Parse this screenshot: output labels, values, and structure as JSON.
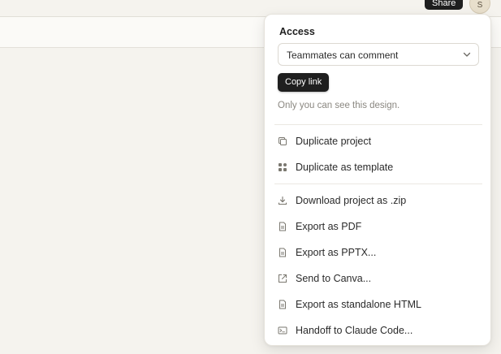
{
  "header": {
    "share_label": "Share",
    "avatar_initial": "S"
  },
  "panel": {
    "access_title": "Access",
    "access_value": "Teammates can comment",
    "copy_link_label": "Copy link",
    "visibility_note": "Only you can see this design.",
    "items": [
      {
        "label": "Duplicate project",
        "icon": "duplicate-icon"
      },
      {
        "label": "Duplicate as template",
        "icon": "template-icon"
      },
      {
        "label": "Download project as .zip",
        "icon": "download-icon"
      },
      {
        "label": "Export as PDF",
        "icon": "file-icon"
      },
      {
        "label": "Export as PPTX...",
        "icon": "file-icon"
      },
      {
        "label": "Send to Canva...",
        "icon": "external-link-icon"
      },
      {
        "label": "Export as standalone HTML",
        "icon": "file-icon"
      },
      {
        "label": "Handoff to Claude Code...",
        "icon": "terminal-icon"
      }
    ]
  }
}
